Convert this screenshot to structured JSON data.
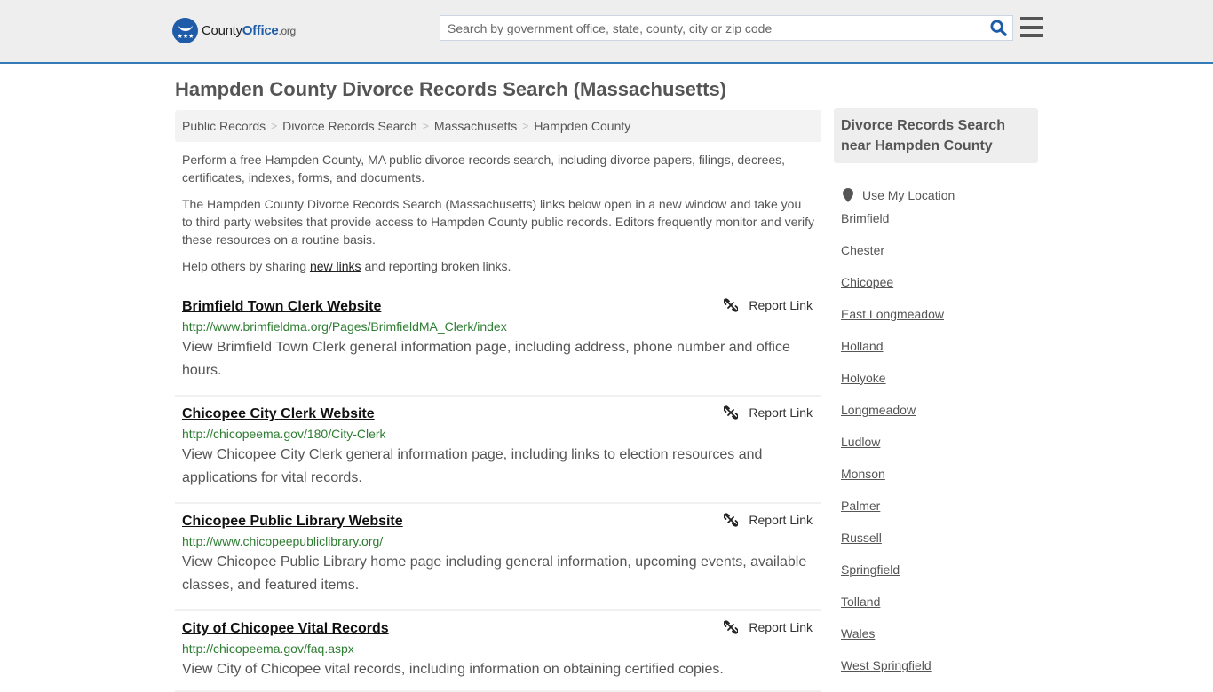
{
  "header": {
    "logo": {
      "name": "County",
      "accent": "Office",
      "suffix": ".org"
    },
    "search": {
      "placeholder": "Search by government office, state, county, city or zip code",
      "value": ""
    },
    "icons": {
      "search": "search-icon",
      "menu": "hamburger-menu-icon"
    }
  },
  "colors": {
    "brand": "#1e5ba8",
    "header_border": "#337ab7",
    "url_green": "#2e7d32",
    "text": "#555555"
  },
  "page_title": "Hampden County Divorce Records Search (Massachusetts)",
  "breadcrumb": [
    "Public Records",
    "Divorce Records Search",
    "Massachusetts",
    "Hampden County"
  ],
  "intro": {
    "p1": "Perform a free Hampden County, MA public divorce records search, including divorce papers, filings, decrees, certificates, indexes, forms, and documents.",
    "p2": "The Hampden County Divorce Records Search (Massachusetts) links below open in a new window and take you to third party websites that provide access to Hampden County public records. Editors frequently monitor and verify these resources on a routine basis.",
    "p3_before": "Help others by sharing ",
    "p3_link": "new links",
    "p3_after": " and reporting broken links."
  },
  "report_label": "Report Link",
  "results": [
    {
      "title": "Brimfield Town Clerk Website",
      "url": "http://www.brimfieldma.org/Pages/BrimfieldMA_Clerk/index",
      "description": "View Brimfield Town Clerk general information page, including address, phone number and office hours."
    },
    {
      "title": "Chicopee City Clerk Website",
      "url": "http://chicopeema.gov/180/City-Clerk",
      "description": "View Chicopee City Clerk general information page, including links to election resources and applications for vital records."
    },
    {
      "title": "Chicopee Public Library Website",
      "url": "http://www.chicopeepubliclibrary.org/",
      "description": "View Chicopee Public Library home page including general information, upcoming events, available classes, and featured items."
    },
    {
      "title": "City of Chicopee Vital Records",
      "url": "http://chicopeema.gov/faq.aspx",
      "description": "View City of Chicopee vital records, including information on obtaining certified copies."
    }
  ],
  "sidebar": {
    "heading": "Divorce Records Search near Hampden County",
    "use_location": "Use My Location",
    "places": [
      "Brimfield",
      "Chester",
      "Chicopee",
      "East Longmeadow",
      "Holland",
      "Holyoke",
      "Longmeadow",
      "Ludlow",
      "Monson",
      "Palmer",
      "Russell",
      "Springfield",
      "Tolland",
      "Wales",
      "West Springfield"
    ]
  }
}
